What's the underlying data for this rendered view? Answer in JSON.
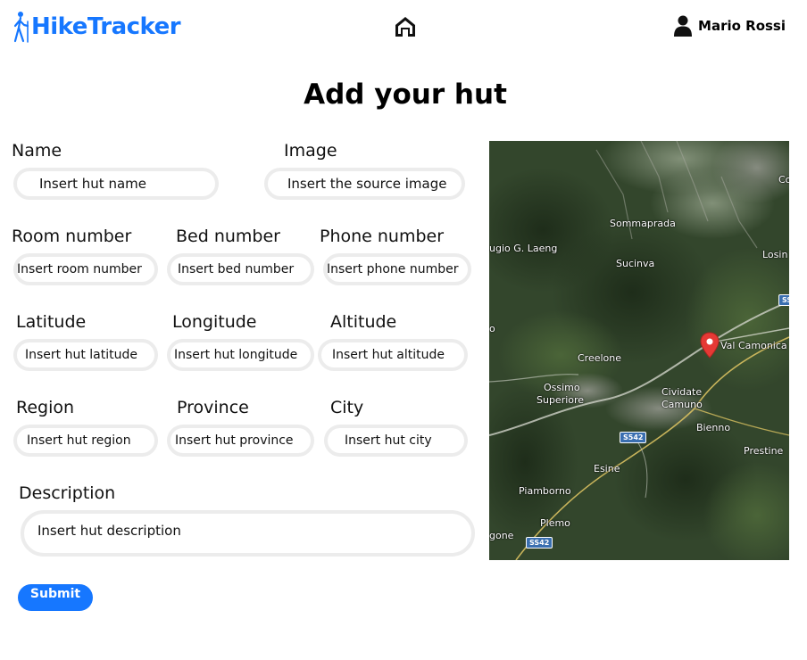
{
  "header": {
    "brand": "HikeTracker",
    "user_name": "Mario Rossi"
  },
  "page_title": "Add your hut",
  "form": {
    "name": {
      "label": "Name",
      "placeholder": "Insert hut name"
    },
    "image": {
      "label": "Image",
      "placeholder": "Insert the source image"
    },
    "room_number": {
      "label": "Room number",
      "placeholder": "Insert room number"
    },
    "bed_number": {
      "label": "Bed number",
      "placeholder": "Insert bed number"
    },
    "phone_number": {
      "label": "Phone number",
      "placeholder": "Insert phone number"
    },
    "latitude": {
      "label": "Latitude",
      "placeholder": "Insert hut latitude"
    },
    "longitude": {
      "label": "Longitude",
      "placeholder": "Insert hut longitude"
    },
    "altitude": {
      "label": "Altitude",
      "placeholder": "Insert hut altitude"
    },
    "region": {
      "label": "Region",
      "placeholder": "Insert hut region"
    },
    "province": {
      "label": "Province",
      "placeholder": "Insert hut province"
    },
    "city": {
      "label": "City",
      "placeholder": "Insert hut city"
    },
    "description": {
      "label": "Description",
      "placeholder": "Insert hut description"
    },
    "submit_label": "Submit"
  },
  "map": {
    "place_labels": [
      "Sommaprada",
      "ugio G. Laeng",
      "Sucinva",
      "Losin",
      "Val Camonica",
      "Creelone",
      "Ossimo",
      "Superiore",
      "Cividate",
      "Camuno",
      "Bienno",
      "Prestine",
      "Esine",
      "Piamborno",
      "Plemo",
      "gone",
      "Co",
      "Se",
      "o"
    ],
    "road_labels": [
      "S542",
      "SS42",
      "SS"
    ],
    "marker_color": "#e53935"
  },
  "colors": {
    "accent": "#1677ff",
    "field_border": "#ececec"
  }
}
